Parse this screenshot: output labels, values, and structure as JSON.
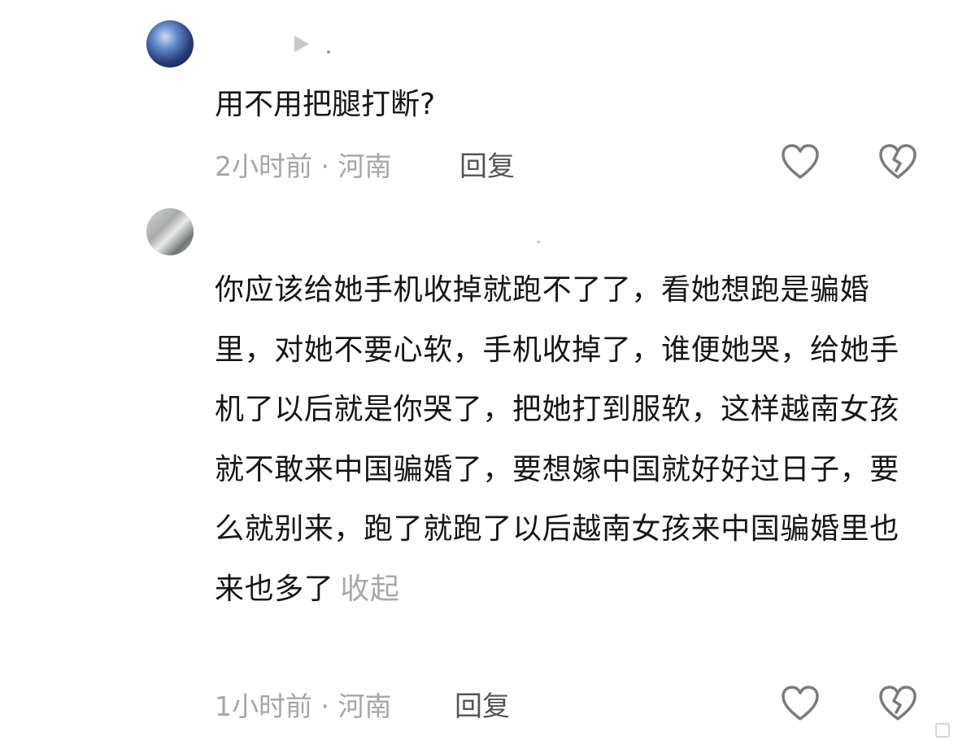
{
  "comments": [
    {
      "content": "用不用把腿打断?",
      "time_location": "2小时前 · 河南",
      "reply_label": "回复"
    },
    {
      "content": "你应该给她手机收掉就跑不了了，看她想跑是骗婚里，对她不要心软，手机收掉了，谁便她哭，给她手机了以后就是你哭了，把她打到服软，这样越南女孩就不敢来中国骗婚了，要想嫁中国就好好过日子，要么就别来，跑了就跑了以后越南女孩来中国骗婚里也来也多了",
      "collapse_label": "收起",
      "time_location": "1小时前 · 河南",
      "reply_label": "回复"
    }
  ],
  "icons": {
    "like": "heart-outline-icon",
    "dislike": "broken-heart-icon",
    "badge": "play-icon"
  },
  "colors": {
    "text": "#161616",
    "meta": "#a6a6a6",
    "reply": "#555555",
    "icon_stroke": "#7b7b7b"
  }
}
